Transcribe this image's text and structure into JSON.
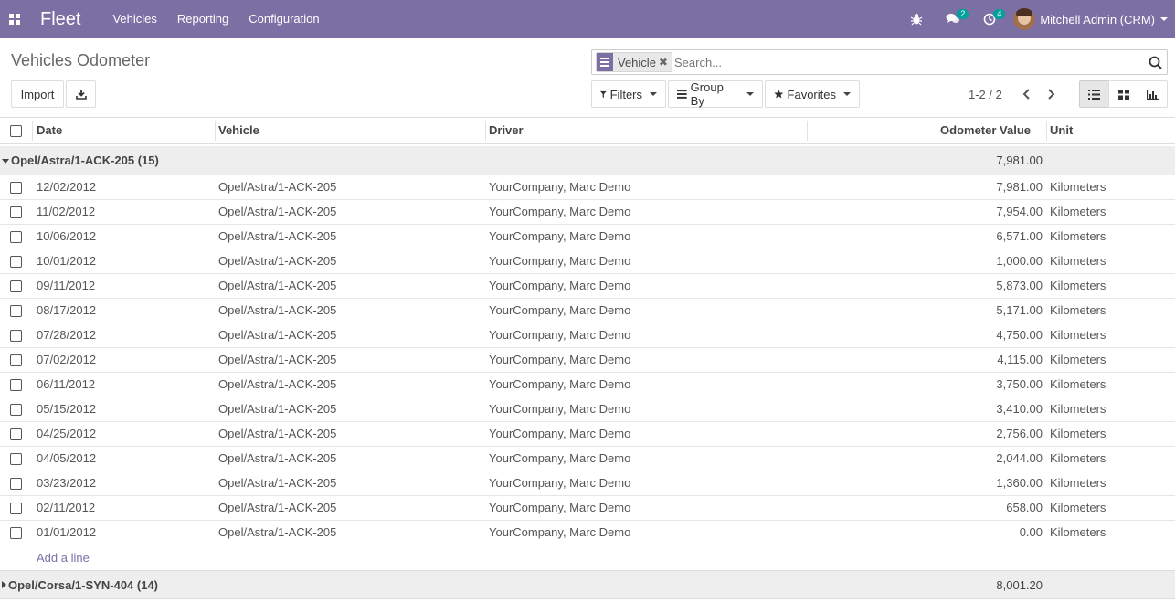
{
  "navbar": {
    "brand": "Fleet",
    "menu": [
      {
        "label": "Vehicles"
      },
      {
        "label": "Reporting"
      },
      {
        "label": "Configuration"
      }
    ],
    "messages_badge": "2",
    "activities_badge": "4",
    "user_name": "Mitchell Admin (CRM)",
    "color": "#7c6fa4"
  },
  "control_panel": {
    "title": "Vehicles Odometer",
    "import_label": "Import",
    "search": {
      "facet_value": "Vehicle",
      "placeholder": "Search..."
    },
    "filters_label": "Filters",
    "group_by_label": "Group By",
    "favorites_label": "Favorites",
    "pager": "1-2 / 2"
  },
  "table": {
    "columns": [
      "Date",
      "Vehicle",
      "Driver",
      "Odometer Value",
      "Unit"
    ],
    "groups": [
      {
        "label": "Opel/Astra/1-ACK-205 (15)",
        "total": "7,981.00",
        "expanded": true,
        "rows": [
          {
            "date": "12/02/2012",
            "vehicle": "Opel/Astra/1-ACK-205",
            "driver": "YourCompany, Marc Demo",
            "odometer": "7,981.00",
            "unit": "Kilometers"
          },
          {
            "date": "11/02/2012",
            "vehicle": "Opel/Astra/1-ACK-205",
            "driver": "YourCompany, Marc Demo",
            "odometer": "7,954.00",
            "unit": "Kilometers"
          },
          {
            "date": "10/06/2012",
            "vehicle": "Opel/Astra/1-ACK-205",
            "driver": "YourCompany, Marc Demo",
            "odometer": "6,571.00",
            "unit": "Kilometers"
          },
          {
            "date": "10/01/2012",
            "vehicle": "Opel/Astra/1-ACK-205",
            "driver": "YourCompany, Marc Demo",
            "odometer": "1,000.00",
            "unit": "Kilometers"
          },
          {
            "date": "09/11/2012",
            "vehicle": "Opel/Astra/1-ACK-205",
            "driver": "YourCompany, Marc Demo",
            "odometer": "5,873.00",
            "unit": "Kilometers"
          },
          {
            "date": "08/17/2012",
            "vehicle": "Opel/Astra/1-ACK-205",
            "driver": "YourCompany, Marc Demo",
            "odometer": "5,171.00",
            "unit": "Kilometers"
          },
          {
            "date": "07/28/2012",
            "vehicle": "Opel/Astra/1-ACK-205",
            "driver": "YourCompany, Marc Demo",
            "odometer": "4,750.00",
            "unit": "Kilometers"
          },
          {
            "date": "07/02/2012",
            "vehicle": "Opel/Astra/1-ACK-205",
            "driver": "YourCompany, Marc Demo",
            "odometer": "4,115.00",
            "unit": "Kilometers"
          },
          {
            "date": "06/11/2012",
            "vehicle": "Opel/Astra/1-ACK-205",
            "driver": "YourCompany, Marc Demo",
            "odometer": "3,750.00",
            "unit": "Kilometers"
          },
          {
            "date": "05/15/2012",
            "vehicle": "Opel/Astra/1-ACK-205",
            "driver": "YourCompany, Marc Demo",
            "odometer": "3,410.00",
            "unit": "Kilometers"
          },
          {
            "date": "04/25/2012",
            "vehicle": "Opel/Astra/1-ACK-205",
            "driver": "YourCompany, Marc Demo",
            "odometer": "2,756.00",
            "unit": "Kilometers"
          },
          {
            "date": "04/05/2012",
            "vehicle": "Opel/Astra/1-ACK-205",
            "driver": "YourCompany, Marc Demo",
            "odometer": "2,044.00",
            "unit": "Kilometers"
          },
          {
            "date": "03/23/2012",
            "vehicle": "Opel/Astra/1-ACK-205",
            "driver": "YourCompany, Marc Demo",
            "odometer": "1,360.00",
            "unit": "Kilometers"
          },
          {
            "date": "02/11/2012",
            "vehicle": "Opel/Astra/1-ACK-205",
            "driver": "YourCompany, Marc Demo",
            "odometer": "658.00",
            "unit": "Kilometers"
          },
          {
            "date": "01/01/2012",
            "vehicle": "Opel/Astra/1-ACK-205",
            "driver": "YourCompany, Marc Demo",
            "odometer": "0.00",
            "unit": "Kilometers"
          }
        ]
      },
      {
        "label": "Opel/Corsa/1-SYN-404 (14)",
        "total": "8,001.20",
        "expanded": false,
        "rows": []
      }
    ],
    "add_line_label": "Add a line"
  }
}
